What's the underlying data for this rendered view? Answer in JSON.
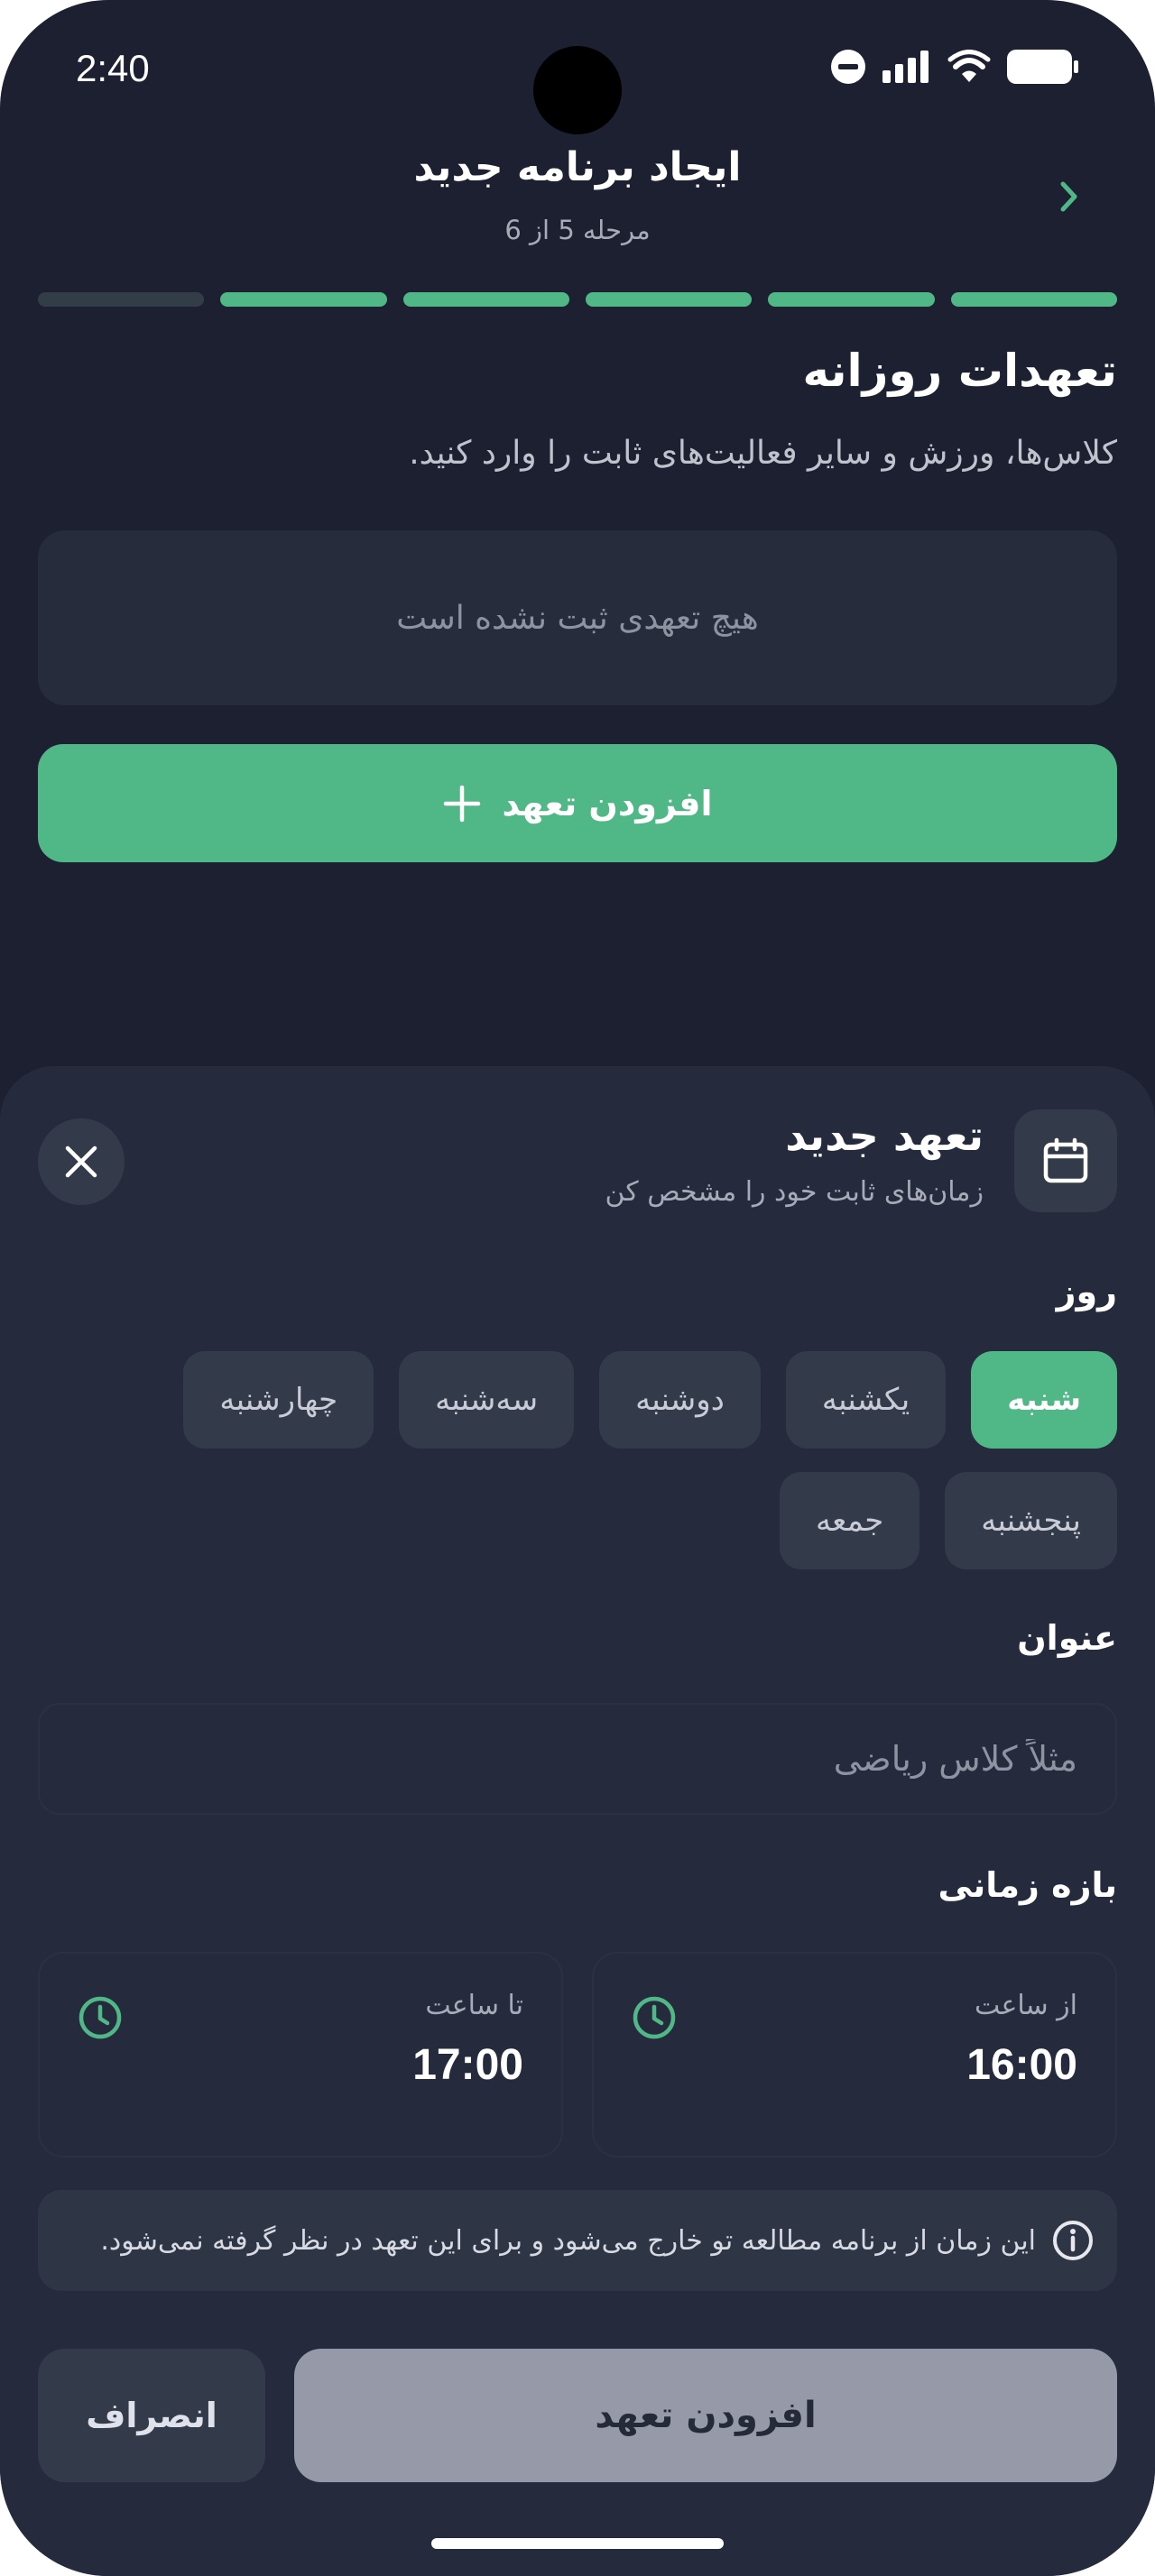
{
  "status_bar": {
    "time": "2:40"
  },
  "header": {
    "title": "ایجاد برنامه جدید",
    "step": "مرحله 5 از 6",
    "progress": {
      "completed": 5,
      "total": 6
    }
  },
  "section": {
    "title": "تعهدات روزانه",
    "description": "کلاس‌ها، ورزش و سایر فعالیت‌های ثابت را وارد کنید.",
    "empty_text": "هیچ تعهدی ثبت نشده است",
    "add_button": "افزودن تعهد"
  },
  "sheet": {
    "title": "تعهد جدید",
    "subtitle": "زمان‌های ثابت خود را مشخص کن",
    "day_label": "روز",
    "days": [
      {
        "label": "شنبه",
        "selected": true
      },
      {
        "label": "یکشنبه",
        "selected": false
      },
      {
        "label": "دوشنبه",
        "selected": false
      },
      {
        "label": "سه‌شنبه",
        "selected": false
      },
      {
        "label": "چهارشنبه",
        "selected": false
      },
      {
        "label": "پنجشنبه",
        "selected": false
      },
      {
        "label": "جمعه",
        "selected": false
      }
    ],
    "title_label": "عنوان",
    "title_placeholder": "مثلاً کلاس ریاضی",
    "time_label": "بازه زمانی",
    "from": {
      "caption": "از ساعت",
      "value": "16:00"
    },
    "to": {
      "caption": "تا ساعت",
      "value": "17:00"
    },
    "info": "این زمان از برنامه مطالعه تو خارج می‌شود و برای این تعهد در نظر گرفته نمی‌شود.",
    "submit": "افزودن تعهد",
    "cancel": "انصراف"
  },
  "colors": {
    "accent": "#50b787",
    "background": "#1c2030",
    "sheet": "#252b3c"
  }
}
